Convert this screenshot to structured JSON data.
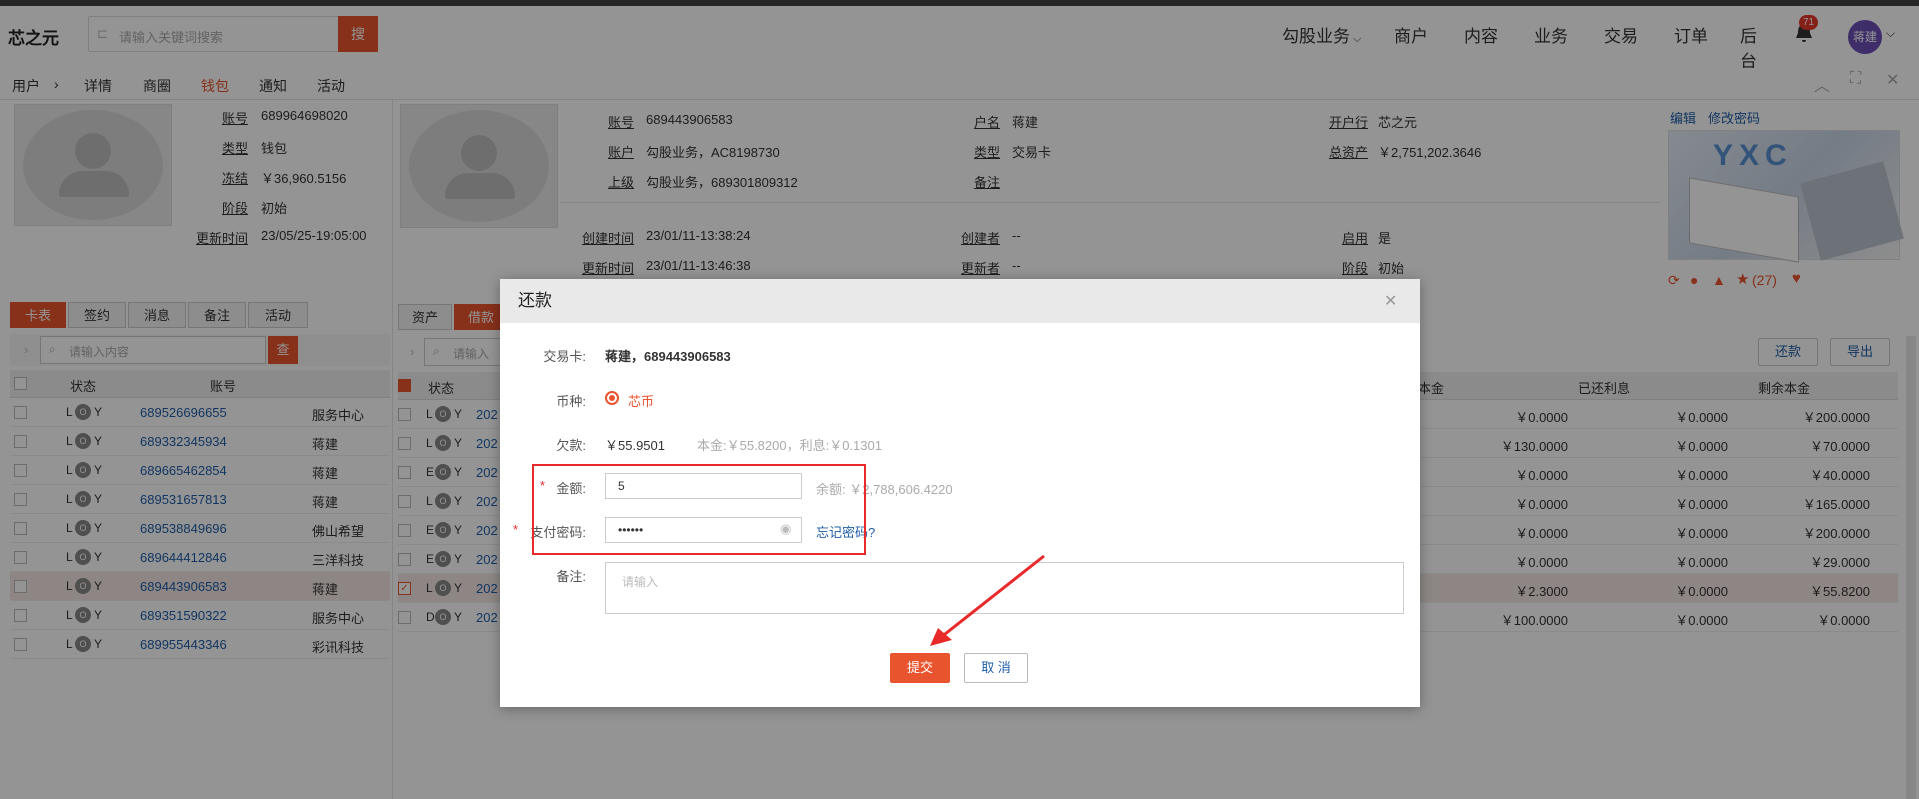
{
  "app": {
    "logo": "芯之元",
    "search_placeholder": "请输入关键词搜索",
    "search_button": "搜",
    "badge_count": "71",
    "user": "蒋建"
  },
  "nav": [
    "勾股业务",
    "商户",
    "内容",
    "业务",
    "交易",
    "订单",
    "后台"
  ],
  "breadcrumb": {
    "root": "用户",
    "tabs": [
      "详情",
      "商圈",
      "钱包",
      "通知",
      "活动"
    ],
    "active": "钱包"
  },
  "left_card": {
    "fields": [
      {
        "label": "账号",
        "value": "689964698020"
      },
      {
        "label": "类型",
        "value": "钱包"
      },
      {
        "label": "冻结",
        "value": "￥36,960.5156"
      },
      {
        "label": "阶段",
        "value": "初始"
      },
      {
        "label": "更新时间",
        "value": "23/05/25-19:05:00"
      }
    ]
  },
  "right_card": {
    "col1": [
      {
        "label": "账号",
        "value": "689443906583"
      },
      {
        "label": "账户",
        "value": "勾股业务，AC8198730"
      },
      {
        "label": "上级",
        "value": "勾股业务，689301809312"
      }
    ],
    "col2": [
      {
        "label": "户名",
        "value": "蒋建"
      },
      {
        "label": "类型",
        "value": "交易卡"
      },
      {
        "label": "备注",
        "value": ""
      }
    ],
    "col3": [
      {
        "label": "开户行",
        "value": "芯之元"
      },
      {
        "label": "总资产",
        "value": "￥2,751,202.3646"
      }
    ],
    "meta": [
      {
        "label": "创建时间",
        "value": "23/01/11-13:38:24"
      },
      {
        "label": "创建者",
        "value": "--"
      },
      {
        "label": "启用",
        "value": "是"
      },
      {
        "label": "更新时间",
        "value": "23/01/11-13:46:38"
      },
      {
        "label": "更新者",
        "value": "--"
      },
      {
        "label": "阶段",
        "value": "初始"
      }
    ],
    "actions": {
      "edit": "编辑",
      "change_pwd": "修改密码",
      "stars": "(27)",
      "banner": "YXC"
    }
  },
  "left_tabs": [
    "卡表",
    "签约",
    "消息",
    "备注",
    "活动"
  ],
  "left_search": {
    "placeholder": "请输入内容",
    "button": "查"
  },
  "left_table": {
    "headers": [
      "状态",
      "账号"
    ],
    "rows": [
      {
        "s": "L",
        "acct": "689526696655",
        "name": "服务中心"
      },
      {
        "s": "L",
        "acct": "689332345934",
        "name": "蒋建"
      },
      {
        "s": "L",
        "acct": "689665462854",
        "name": "蒋建"
      },
      {
        "s": "L",
        "acct": "689531657813",
        "name": "蒋建"
      },
      {
        "s": "L",
        "acct": "689538849696",
        "name": "佛山希望"
      },
      {
        "s": "L",
        "acct": "689644412846",
        "name": "三洋科技"
      },
      {
        "s": "L",
        "acct": "689443906583",
        "name": "蒋建"
      },
      {
        "s": "L",
        "acct": "689351590322",
        "name": "服务中心"
      },
      {
        "s": "L",
        "acct": "689955443346",
        "name": "彩讯科技"
      }
    ]
  },
  "right_tabs": [
    "资产",
    "借款"
  ],
  "right_search_placeholder": "请输入",
  "right_buttons": {
    "repay": "还款",
    "export": "导出"
  },
  "right_table": {
    "headers": [
      "状态",
      "本金",
      "已还利息",
      "剩余本金"
    ],
    "rows": [
      {
        "s": "L",
        "date": "202",
        "p": "￥0.0000",
        "i": "￥0.0000",
        "r": "￥200.0000"
      },
      {
        "s": "L",
        "date": "202",
        "p": "￥130.0000",
        "i": "￥0.0000",
        "r": "￥70.0000"
      },
      {
        "s": "E",
        "date": "202",
        "p": "￥0.0000",
        "i": "￥0.0000",
        "r": "￥40.0000"
      },
      {
        "s": "L",
        "date": "202",
        "p": "￥0.0000",
        "i": "￥0.0000",
        "r": "￥165.0000"
      },
      {
        "s": "E",
        "date": "202",
        "p": "￥0.0000",
        "i": "￥0.0000",
        "r": "￥200.0000"
      },
      {
        "s": "E",
        "date": "202",
        "p": "￥0.0000",
        "i": "￥0.0000",
        "r": "￥29.0000"
      },
      {
        "s": "L",
        "date": "202",
        "p": "￥2.3000",
        "i": "￥0.0000",
        "r": "￥55.8200"
      },
      {
        "s": "D",
        "date": "202",
        "p": "￥100.0000",
        "i": "￥0.0000",
        "r": "￥0.0000"
      }
    ]
  },
  "modal": {
    "title": "还款",
    "card_label": "交易卡:",
    "card_value": "蒋建，689443906583",
    "currency_label": "币种:",
    "currency_value": "芯币",
    "debt_label": "欠款:",
    "debt_value": "￥55.9501",
    "debt_detail": "本金:￥55.8200，利息:￥0.1301",
    "amount_label": "金额:",
    "amount_value": "5",
    "balance": "余额: ￥2,788,606.4220",
    "pwd_label": "支付密码:",
    "pwd_value": "••••••",
    "forgot": "忘记密码?",
    "remark_label": "备注:",
    "remark_placeholder": "请输入",
    "submit": "提交",
    "cancel": "取 消"
  }
}
